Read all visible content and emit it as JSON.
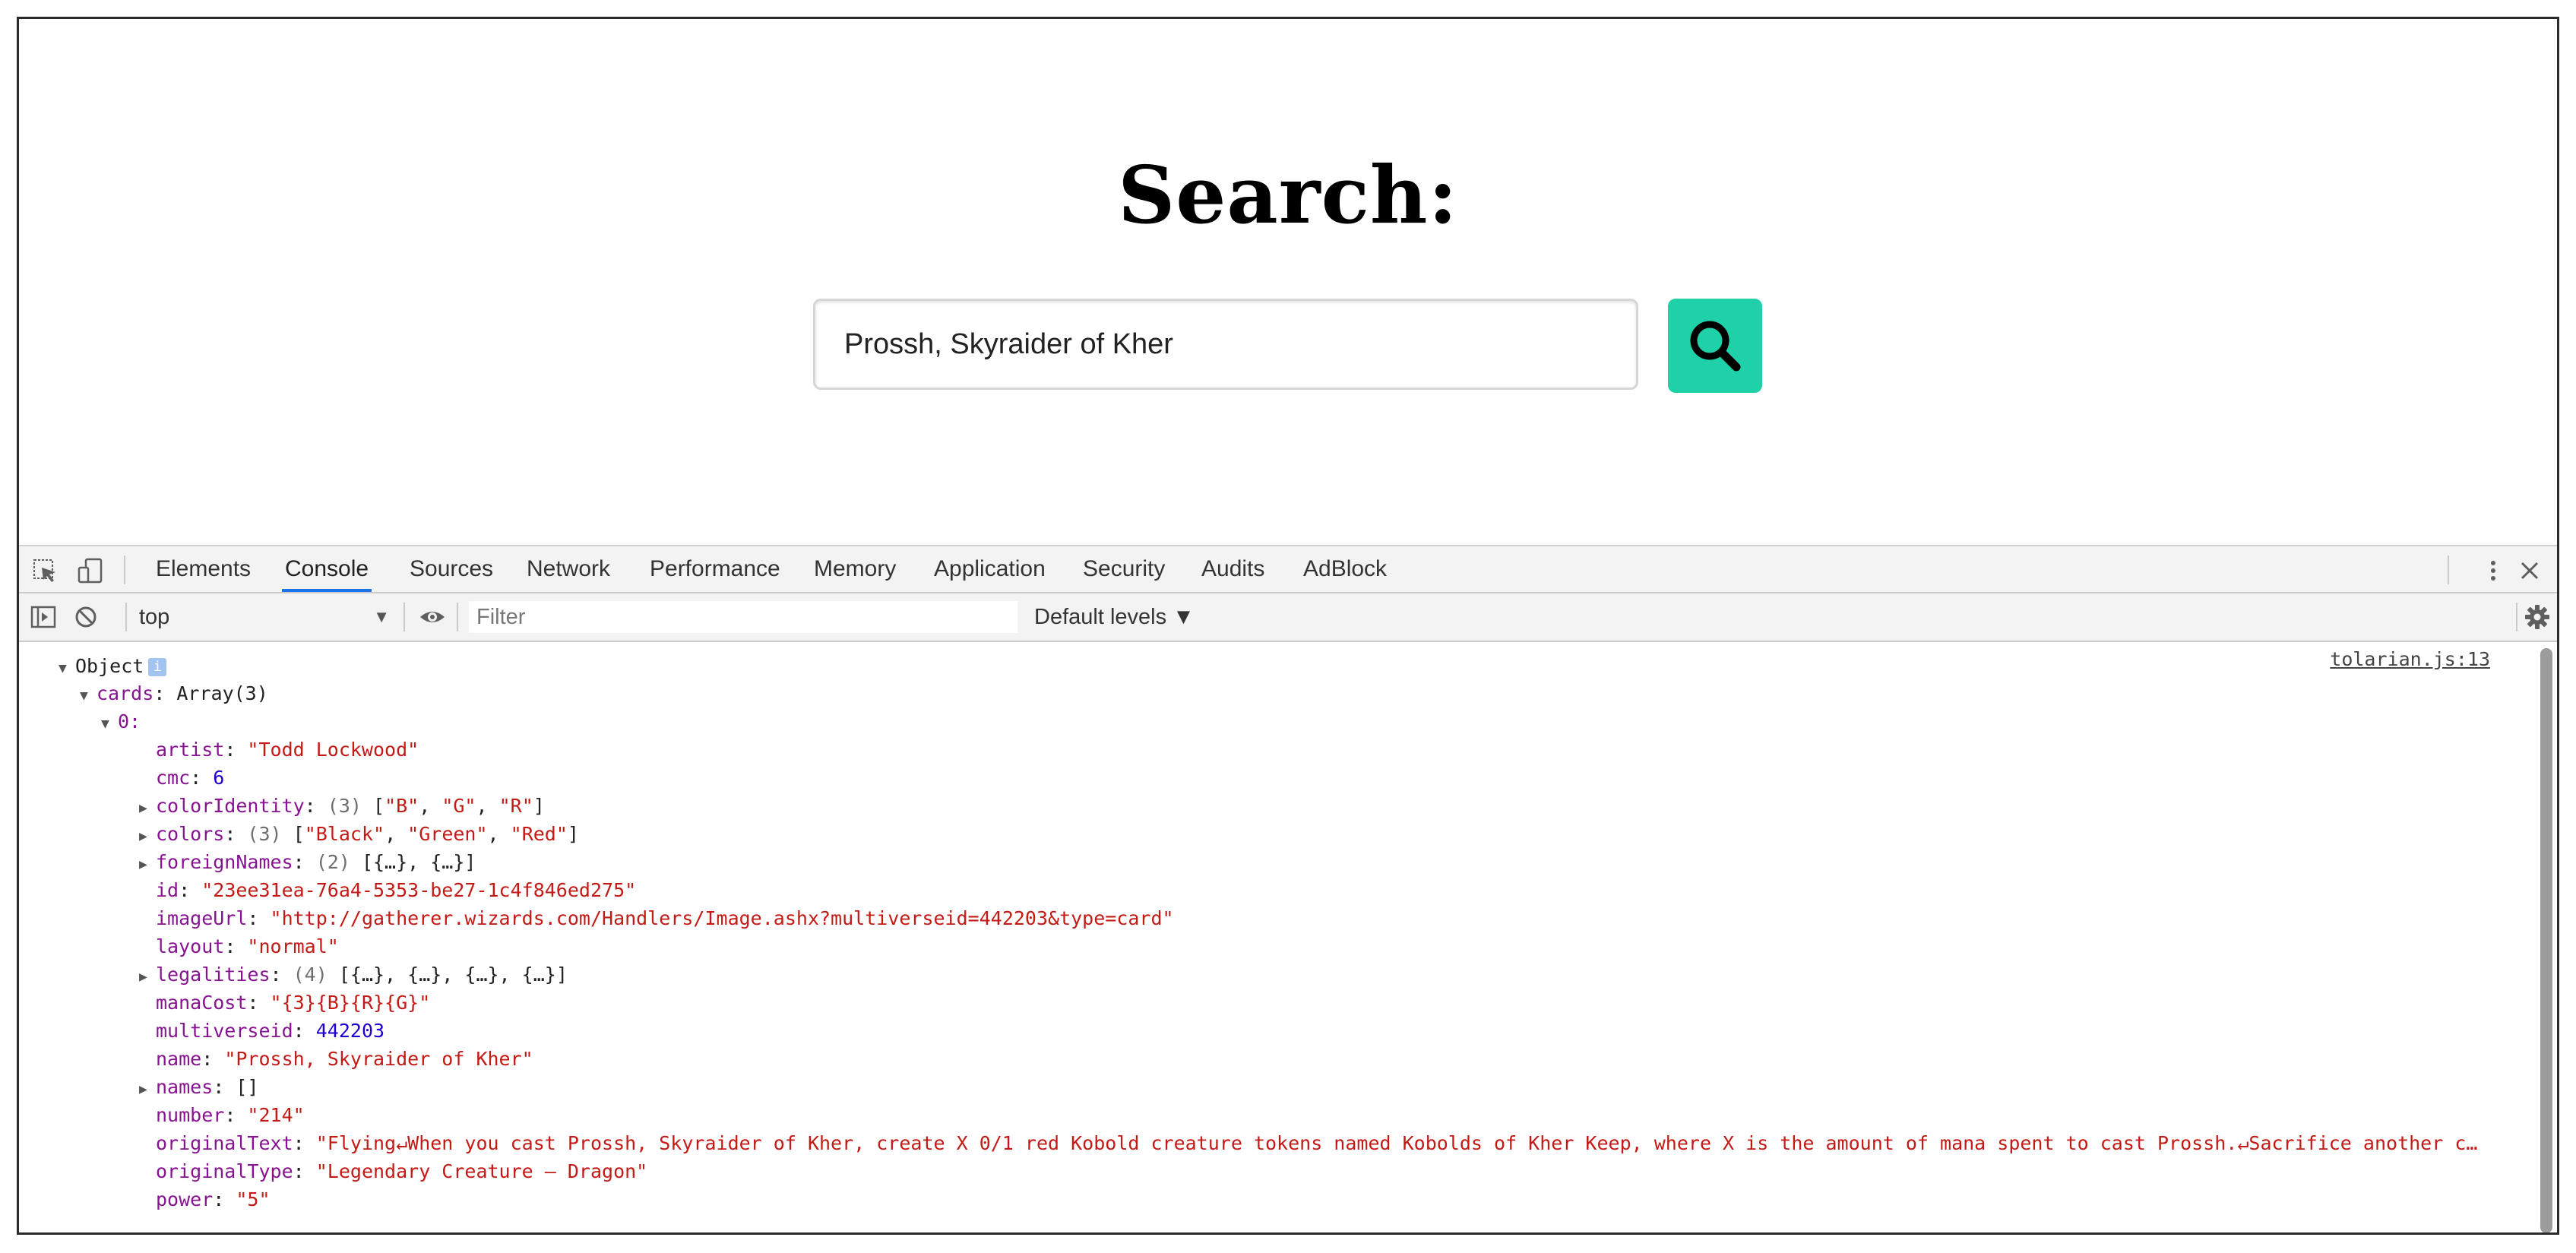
{
  "page": {
    "heading": "Search:",
    "search_value": "Prossh, Skyraider of Kher",
    "accent_color": "#1fd1a8"
  },
  "devtools": {
    "tabs": [
      "Elements",
      "Console",
      "Sources",
      "Network",
      "Performance",
      "Memory",
      "Application",
      "Security",
      "Audits",
      "AdBlock"
    ],
    "active_tab": "Console",
    "context": "top",
    "filter_placeholder": "Filter",
    "levels": "Default levels ▼",
    "source_link": "tolarian.js:13"
  },
  "console": {
    "root": "Object",
    "cards_key": "cards",
    "cards_type": "Array(3)",
    "index_label": "0:",
    "fields": [
      {
        "key": "artist",
        "value": "\"Todd Lockwood\"",
        "kind": "str",
        "expandable": false
      },
      {
        "key": "cmc",
        "value": "6",
        "kind": "num",
        "expandable": false
      },
      {
        "key": "colorIdentity",
        "count": "(3)",
        "value": "[\"B\", \"G\", \"R\"]",
        "kind": "arr",
        "expandable": true
      },
      {
        "key": "colors",
        "count": "(3)",
        "value": "[\"Black\", \"Green\", \"Red\"]",
        "kind": "arr",
        "expandable": true
      },
      {
        "key": "foreignNames",
        "count": "(2)",
        "value": "[{…}, {…}]",
        "kind": "obj",
        "expandable": true
      },
      {
        "key": "id",
        "value": "\"23ee31ea-76a4-5353-be27-1c4f846ed275\"",
        "kind": "str",
        "expandable": false
      },
      {
        "key": "imageUrl",
        "value": "\"http://gatherer.wizards.com/Handlers/Image.ashx?multiverseid=442203&type=card\"",
        "kind": "str",
        "expandable": false
      },
      {
        "key": "layout",
        "value": "\"normal\"",
        "kind": "str",
        "expandable": false
      },
      {
        "key": "legalities",
        "count": "(4)",
        "value": "[{…}, {…}, {…}, {…}]",
        "kind": "obj",
        "expandable": true
      },
      {
        "key": "manaCost",
        "value": "\"{3}{B}{R}{G}\"",
        "kind": "str",
        "expandable": false
      },
      {
        "key": "multiverseid",
        "value": "442203",
        "kind": "num",
        "expandable": false
      },
      {
        "key": "name",
        "value": "\"Prossh, Skyraider of Kher\"",
        "kind": "str",
        "expandable": false
      },
      {
        "key": "names",
        "value": "[]",
        "kind": "obj",
        "expandable": true
      },
      {
        "key": "number",
        "value": "\"214\"",
        "kind": "str",
        "expandable": false
      },
      {
        "key": "originalText",
        "value": "\"Flying↵When you cast Prossh, Skyraider of Kher, create X 0/1 red Kobold creature tokens named Kobolds of Kher Keep, where X is the amount of mana spent to cast Prossh.↵Sacrifice another c…",
        "kind": "str",
        "expandable": false
      },
      {
        "key": "originalType",
        "value": "\"Legendary Creature — Dragon\"",
        "kind": "str",
        "expandable": false
      },
      {
        "key": "power",
        "value": "\"5\"",
        "kind": "str",
        "expandable": false
      }
    ]
  }
}
